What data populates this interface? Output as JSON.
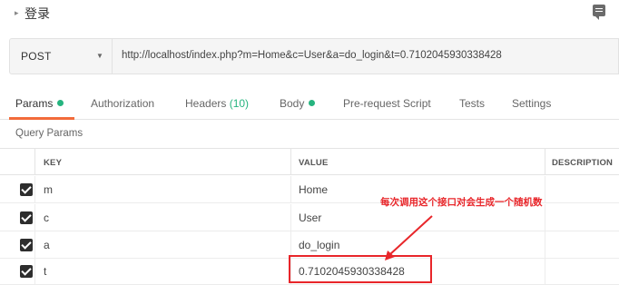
{
  "header": {
    "request_name": "登录",
    "caret": "▸"
  },
  "url_bar": {
    "method": "POST",
    "url": "http://localhost/index.php?m=Home&c=User&a=do_login&t=0.7102045930338428"
  },
  "tabs": [
    {
      "label": "Params",
      "dot": true,
      "active": true
    },
    {
      "label": "Authorization"
    },
    {
      "label": "Headers",
      "count": "(10)"
    },
    {
      "label": "Body",
      "dot": true
    },
    {
      "label": "Pre-request Script"
    },
    {
      "label": "Tests"
    },
    {
      "label": "Settings"
    }
  ],
  "query_params": {
    "title": "Query Params",
    "columns": {
      "key": "KEY",
      "value": "VALUE",
      "description": "DESCRIPTION"
    },
    "rows": [
      {
        "key": "m",
        "value": "Home",
        "checked": true
      },
      {
        "key": "c",
        "value": "User",
        "checked": true
      },
      {
        "key": "a",
        "value": "do_login",
        "checked": true
      },
      {
        "key": "t",
        "value": "0.7102045930338428",
        "checked": true
      }
    ]
  },
  "annotation": {
    "text": "每次调用这个接口对会生成一个随机数",
    "color": "#e8262a"
  },
  "colors": {
    "accent": "#f26b3a",
    "green": "#26b47f"
  }
}
